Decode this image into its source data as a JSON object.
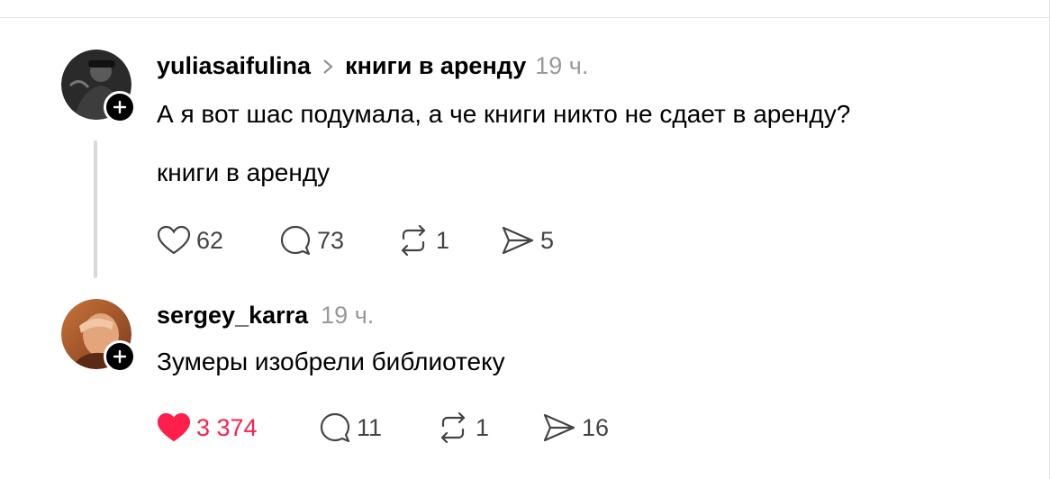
{
  "posts": [
    {
      "username": "yuliasaifulina",
      "topic": "книги в аренду",
      "time": "19 ч.",
      "text": "А я вот шас подумала, а че книги никто не сдает в аренду?",
      "tag_text": "книги в аренду",
      "likes": "62",
      "comments": "73",
      "reposts": "1",
      "shares": "5",
      "liked": false
    },
    {
      "username": "sergey_karra",
      "time": "19 ч.",
      "text": "Зумеры изобрели библиотеку",
      "likes": "3 374",
      "comments": "11",
      "reposts": "1",
      "shares": "16",
      "liked": true
    }
  ],
  "colors": {
    "liked": "#ff1f4b",
    "muted": "#999999",
    "thread_line": "#d9d9d9"
  },
  "icons": [
    "heart-icon",
    "comment-icon",
    "repost-icon",
    "share-icon",
    "plus-icon",
    "chevron-right-icon"
  ]
}
